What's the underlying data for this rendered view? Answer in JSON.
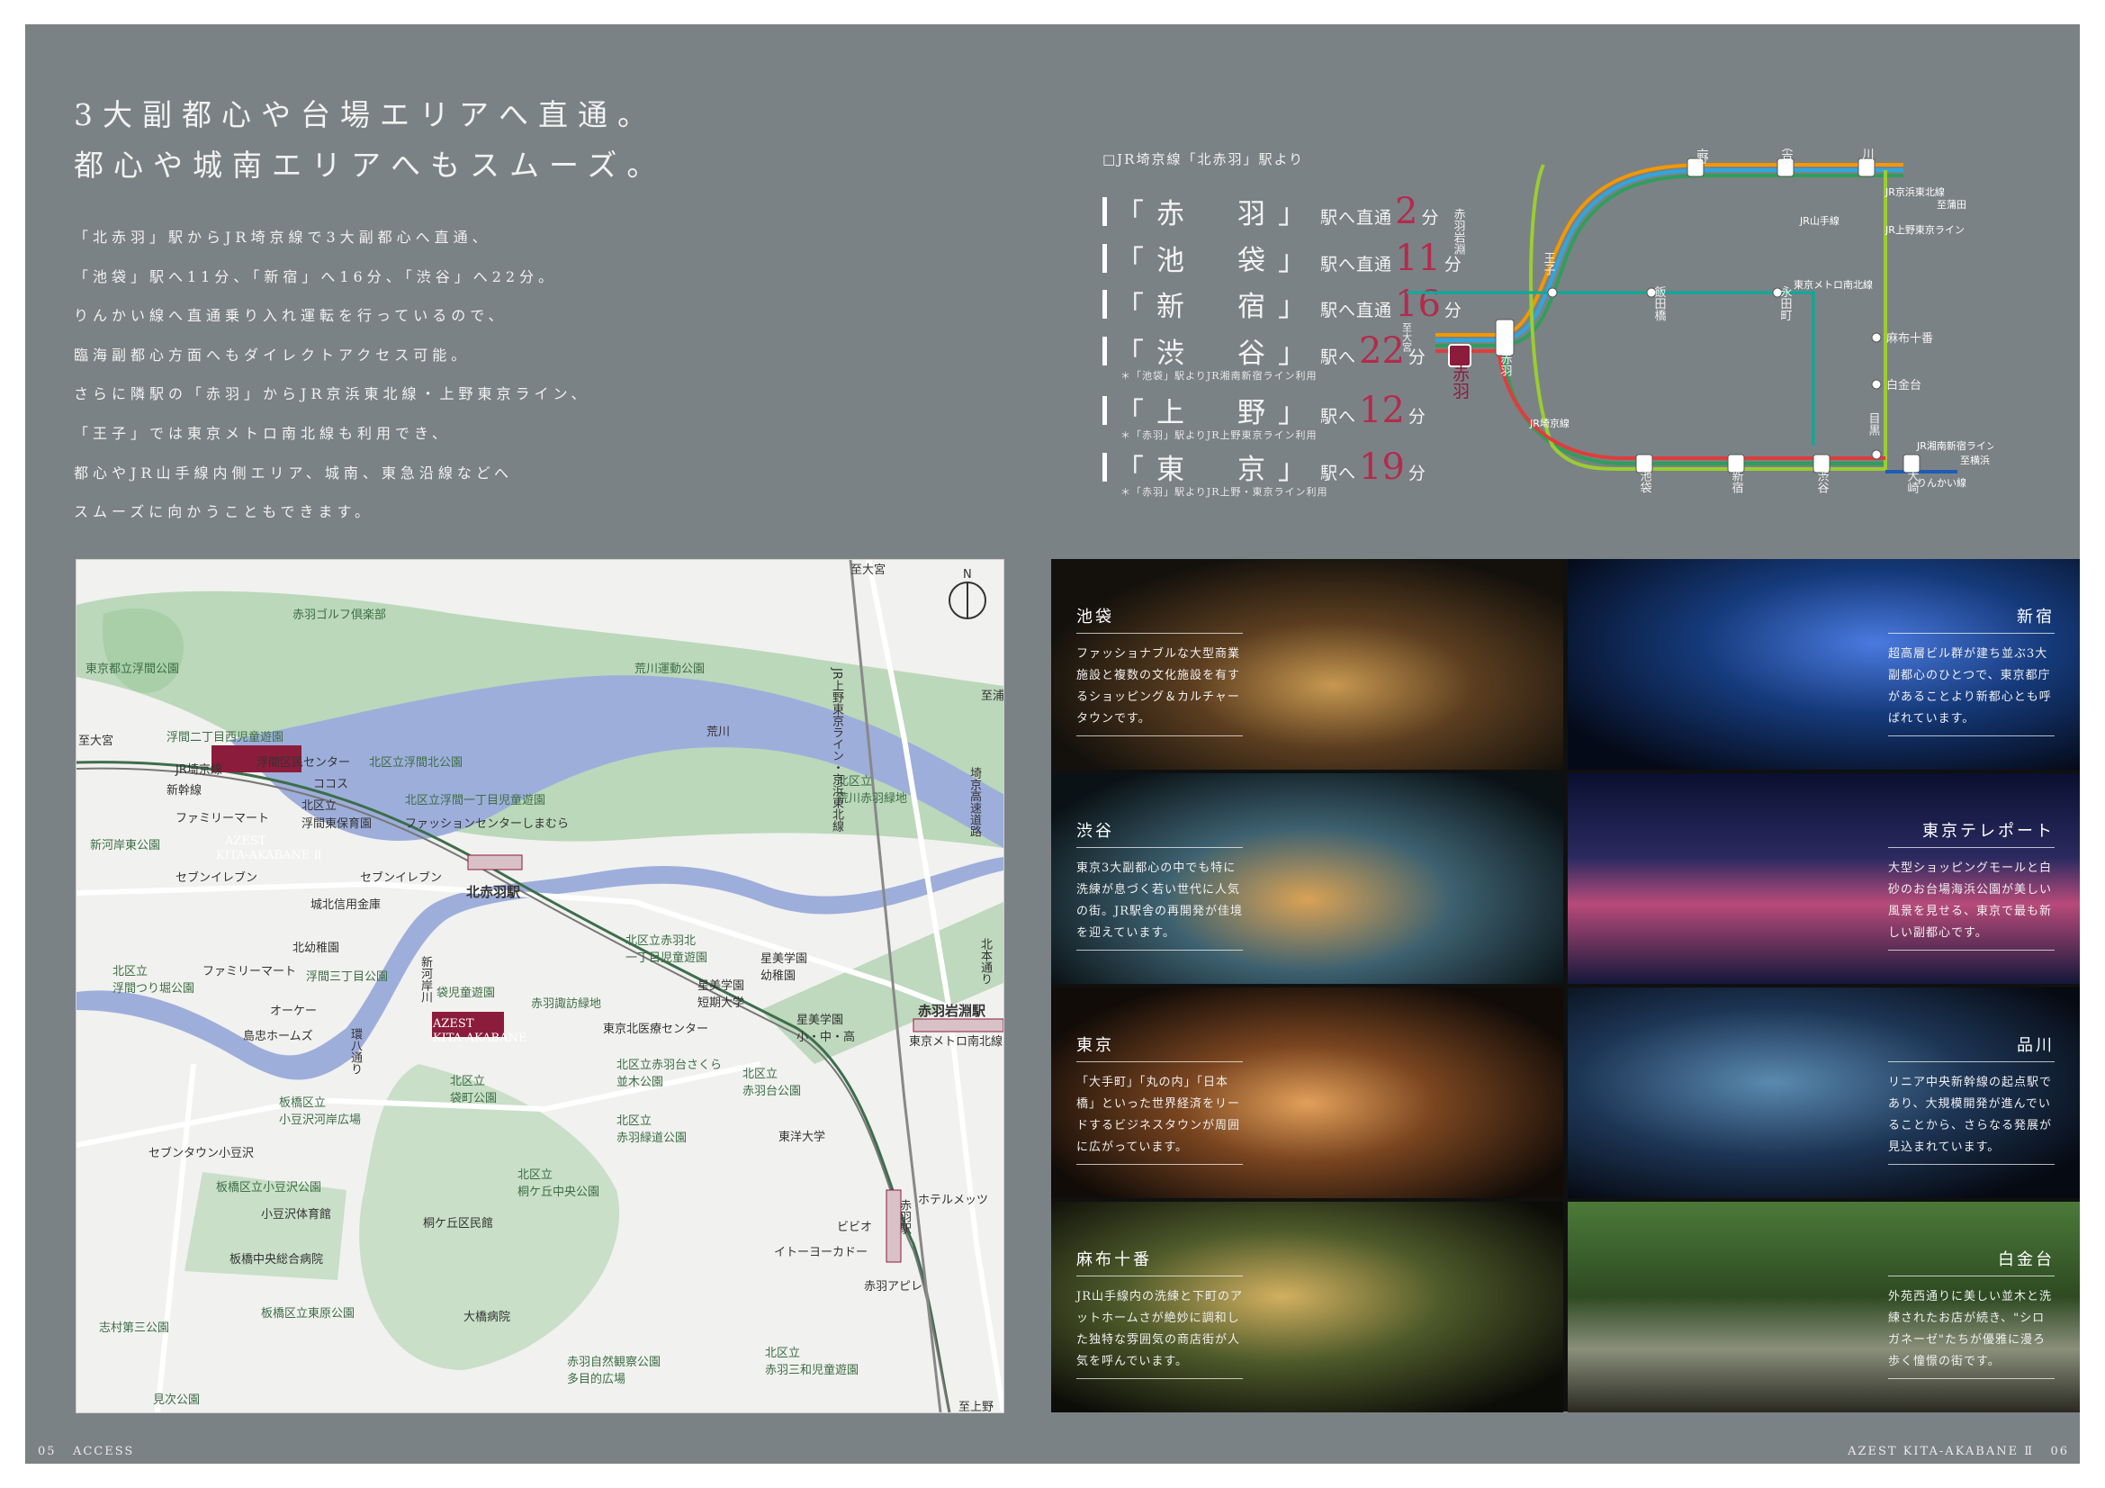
{
  "headline": {
    "line1": "3大副都心や台場エリアへ直通。",
    "line2": "都心や城南エリアへもスムーズ。"
  },
  "body_text": "「北赤羽」駅からJR埼京線で3大副都心へ直通、\n「池袋」駅へ11分、「新宿」へ16分、「渋谷」へ22分。\nりんかい線へ直通乗り入れ運転を行っているので、\n臨海副都心方面へもダイレクトアクセス可能。\nさらに隣駅の「赤羽」からJR京浜東北線・上野東京ライン、\n「王子」では東京メトロ南北線も利用でき、\n都心やJR山手線内側エリア、城南、東急沿線などへ\nスムーズに向かうこともできます。",
  "timetable": {
    "heading": "□JR埼京線「北赤羽」駅より",
    "rows": [
      {
        "station": "「赤　羽」",
        "mid": "駅へ直通",
        "minutes": "2",
        "unit": "分",
        "note": ""
      },
      {
        "station": "「池　袋」",
        "mid": "駅へ直通",
        "minutes": "11",
        "unit": "分",
        "note": ""
      },
      {
        "station": "「新　宿」",
        "mid": "駅へ直通",
        "minutes": "16",
        "unit": "分",
        "note": ""
      },
      {
        "station": "「渋　谷」",
        "mid": "駅へ",
        "minutes": "22",
        "unit": "分",
        "note": "＊「池袋」駅よりJR湘南新宿ライン利用"
      },
      {
        "station": "「上　野」",
        "mid": "駅へ",
        "minutes": "12",
        "unit": "分",
        "note": "＊「赤羽」駅よりJR上野東京ライン利用"
      },
      {
        "station": "「東　京」",
        "mid": "駅へ",
        "minutes": "19",
        "unit": "分",
        "note": "＊「赤羽」駅よりJR上野・東京ライン利用"
      }
    ]
  },
  "route_map": {
    "stations": {
      "kitaakabane": "北赤羽",
      "akabane": "赤羽",
      "akabaneiwabuchi": "赤羽岩淵",
      "oji": "王子",
      "ueno": "上野",
      "tokyo": "東京",
      "shinagawa": "品川",
      "iidabashi": "飯田橋",
      "nagatacho": "永田町",
      "azabujuban": "麻布十番",
      "shirokanedai": "白金台",
      "meguro": "目黒",
      "ikebukuro": "池袋",
      "shinjuku": "新宿",
      "shibuya": "渋谷",
      "osaki": "大崎"
    },
    "lines": {
      "keihin": "JR京浜東北線",
      "yamanote": "JR山手線",
      "ueno_tokyo": "JR上野東京ライン",
      "namboku": "東京メトロ南北線",
      "saikyo": "JR埼京線",
      "shonan": "JR湘南新宿ライン",
      "rinkai": "りんかい線"
    },
    "destinations": {
      "omiya": "至大宮",
      "kamata": "至蒲田",
      "yokohama": "至横浜\n至東京\nテレポート"
    },
    "colors": {
      "saikyo": "#2f9e5c",
      "keihin": "#2ea7e0",
      "ueno_tokyo": "#f39800",
      "yamanote": "#9acd32",
      "shonan": "#e03c3c",
      "namboku": "#00ac9b",
      "rinkai": "#1c5db8",
      "highlight": "#8c1c3c"
    }
  },
  "map": {
    "labels": {
      "golf": "赤羽ゴルフ倶楽部",
      "ukima_park": "東京都立浮間公園",
      "arakawa_park": "荒川運動公園",
      "arakawa": "荒川",
      "omiya_top": "至大宮",
      "urawa": "至浦和美女木",
      "omiya_left": "至大宮",
      "jr_saikyo": "JR埼京線",
      "shinkansen": "新幹線",
      "ukima_nishi": "浮間二丁目西児童遊園",
      "ukima_center": "浮間区民センター",
      "kokos": "ココス",
      "ukima_kita": "北区立浮間北公園",
      "kita_school": "北区立",
      "family1": "ファミリーマート",
      "ukima_hoiku": "浮間東保育園",
      "ukima1_park": "北区立浮間一丁目児童遊園",
      "shimamura": "ファッションセンターしまむら",
      "shingashi_park": "新河岸東公園",
      "azest1": "AZEST",
      "azest1_sub": "KITA-AKABANE Ⅱ",
      "seven1": "セブンイレブン",
      "seven2": "セブンイレブン",
      "kitaakabane_sta": "北赤羽駅",
      "johoku": "城北信用金庫",
      "arakawa_ryokuchi": "北区立\n荒川赤羽緑地",
      "route": "JR上野東京ライン・京浜東北線",
      "saikyo_road": "埼京高速道路",
      "kitayochien": "北幼稚園",
      "family2": "ファミリーマート",
      "ukima3_park": "浮間三丁目公園",
      "shingashi_river": "新河岸川",
      "ukima_pond": "北区立\n浮間つり堀公園",
      "okay": "オーケー",
      "shimachu": "島忠ホームズ",
      "akabanekita": "北区立赤羽北\n一丁目児童遊園",
      "hoshibi_jr": "星美学園\n短期大学",
      "hoshibi_kinder": "星美学園\n幼稚園",
      "fukuro_park": "袋児童遊園",
      "akabane_suwa": "赤羽諏訪緑地",
      "azest2": "AZEST",
      "azest2_sub": "KITA-AKABANE",
      "kita_medical": "東京北医療センター",
      "hoshibi_school": "星美学園\n小・中・高",
      "kita_hondo": "北本通り",
      "iwabuchi_sta": "赤羽岩淵駅",
      "namboku": "東京メトロ南北線",
      "kan8": "環八通り",
      "fukuromachi": "北区立\n袋町公園",
      "sakura": "北区立赤羽台さくら\n並木公園",
      "akabanedai": "北区立\n赤羽台公園",
      "azusawa": "板橋区立\n小豆沢河岸広場",
      "ryokudo": "北区立\n赤羽緑道公園",
      "toyo": "東洋大学",
      "seven_town": "セブンタウン小豆沢",
      "kirigaoka_park": "北区立\n桐ケ丘中央公園",
      "azusawa_park": "板橋区立小豆沢公園",
      "azusawa_gym": "小豆沢体育館",
      "kirigaoka_hall": "桐ケ丘区民館",
      "hotel": "ホテルメッツ",
      "vivi": "ビビオ",
      "itoyokado": "イトーヨーカドー",
      "akabane_sta": "赤羽駅",
      "apire": "赤羽アピレ",
      "itabashi_hosp": "板橋中央総合病院",
      "shimura": "志村第三公園",
      "higashi": "板橋区立東原公園",
      "ohashi": "大橋病院",
      "shizen": "赤羽自然観察公園\n多目的広場",
      "sanwa": "北区立\n赤羽三和児童遊園",
      "mitsugi": "見次公園",
      "ueno": "至上野"
    }
  },
  "photos": [
    {
      "title": "池袋",
      "desc": "ファッショナブルな大型商業施設と複数の文化施設を有するショッピング＆カルチャータウンです。"
    },
    {
      "title": "新宿",
      "desc": "超高層ビル群が建ち並ぶ3大副都心のひとつで、東京都庁があることより新都心とも呼ばれています。"
    },
    {
      "title": "渋谷",
      "desc": "東京3大副都心の中でも特に洗練が息づく若い世代に人気の街。JR駅舎の再開発が佳境を迎えています。"
    },
    {
      "title": "東京テレポート",
      "desc": "大型ショッピングモールと白砂のお台場海浜公園が美しい風景を見せる、東京で最も新しい副都心です。"
    },
    {
      "title": "東京",
      "desc": "「大手町」「丸の内」「日本橋」といった世界経済をリードするビジネスタウンが周囲に広がっています。"
    },
    {
      "title": "品川",
      "desc": "リニア中央新幹線の起点駅であり、大規模開発が進んでいることから、さらなる発展が見込まれています。"
    },
    {
      "title": "麻布十番",
      "desc": "JR山手線内の洗練と下町のアットホームさが絶妙に調和した独特な雰囲気の商店街が人気を呼んでいます。"
    },
    {
      "title": "白金台",
      "desc": "外苑西通りに美しい並木と洗練されたお店が続き、\"シロガネーゼ\"たちが優雅に漫ろ歩く憧憬の街です。"
    }
  ],
  "footer": {
    "left_page": "05",
    "left_section": "ACCESS",
    "right_brand": "AZEST KITA-AKABANE Ⅱ",
    "right_page": "06"
  }
}
